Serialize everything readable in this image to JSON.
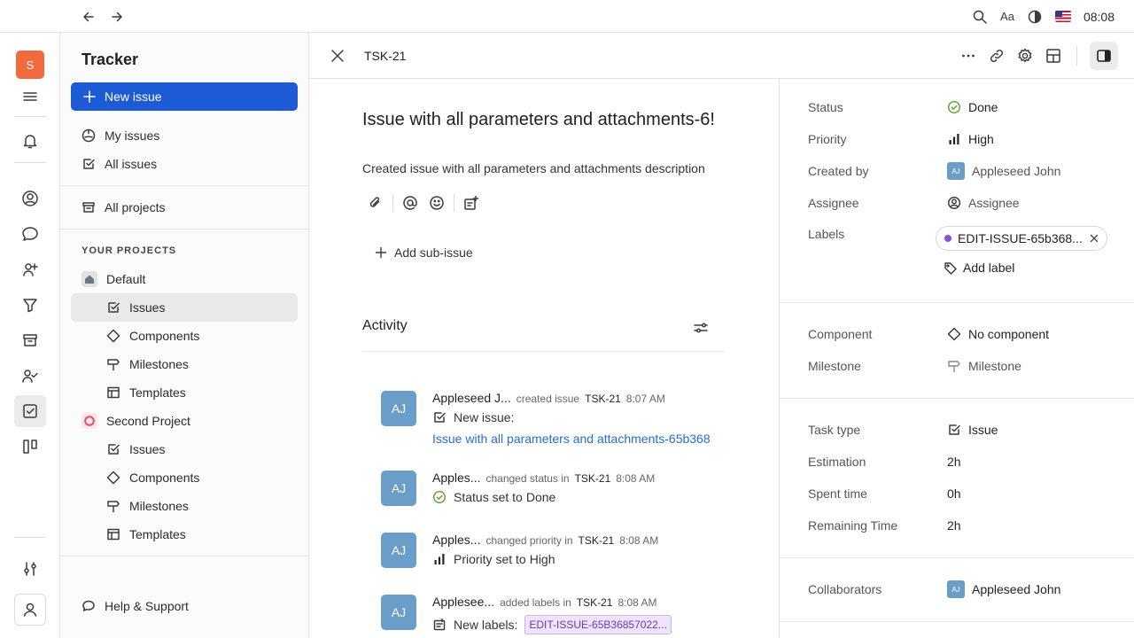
{
  "topbar": {
    "time": "08:08"
  },
  "rail": {
    "workspace_initial": "S"
  },
  "sidebar": {
    "title": "Tracker",
    "new_issue": "New issue",
    "my_issues": "My issues",
    "all_issues": "All issues",
    "all_projects": "All projects",
    "section_label": "YOUR PROJECTS",
    "projects": [
      {
        "name": "Default",
        "items": [
          "Issues",
          "Components",
          "Milestones",
          "Templates"
        ]
      },
      {
        "name": "Second Project",
        "items": [
          "Issues",
          "Components",
          "Milestones",
          "Templates"
        ]
      }
    ],
    "help": "Help & Support"
  },
  "header": {
    "issue_id": "TSK-21"
  },
  "issue": {
    "title": "Issue with all parameters and attachments-6!",
    "description": "Created issue with all parameters and attachments description",
    "add_sub_issue": "Add sub-issue"
  },
  "activity": {
    "title": "Activity",
    "entries": [
      {
        "initials": "AJ",
        "who": "Appleseed J...",
        "action": "created issue",
        "ref": "TSK-21",
        "time": "8:07 AM",
        "text": "New issue:",
        "link": "Issue with all parameters and attachments-65b368"
      },
      {
        "initials": "AJ",
        "who": "Apples...",
        "action": "changed status in",
        "ref": "TSK-21",
        "time": "8:08 AM",
        "text": "Status set to",
        "value": "Done"
      },
      {
        "initials": "AJ",
        "who": "Apples...",
        "action": "changed priority in",
        "ref": "TSK-21",
        "time": "8:08 AM",
        "text": "Priority set to",
        "value": "High"
      },
      {
        "initials": "AJ",
        "who": "Applesee...",
        "action": "added labels in",
        "ref": "TSK-21",
        "time": "8:08 AM",
        "text": "New labels:",
        "chip": "EDIT-ISSUE-65B36857022..."
      }
    ]
  },
  "panel": {
    "status_label": "Status",
    "status_value": "Done",
    "priority_label": "Priority",
    "priority_value": "High",
    "created_by_label": "Created by",
    "created_by_value": "Appleseed John",
    "created_by_initials": "AJ",
    "assignee_label": "Assignee",
    "assignee_value": "Assignee",
    "labels_label": "Labels",
    "label_chip": "EDIT-ISSUE-65b368...",
    "add_label": "Add label",
    "component_label": "Component",
    "component_value": "No component",
    "milestone_label": "Milestone",
    "milestone_value": "Milestone",
    "task_type_label": "Task type",
    "task_type_value": "Issue",
    "estimation_label": "Estimation",
    "estimation_value": "2h",
    "spent_label": "Spent time",
    "spent_value": "0h",
    "remaining_label": "Remaining Time",
    "remaining_value": "2h",
    "collaborators_label": "Collaborators",
    "collaborators_value": "Appleseed John",
    "collaborators_initials": "AJ"
  },
  "colors": {
    "accent": "#1d5bd6",
    "link": "#2a6bd1",
    "avatar": "#6a9ec8",
    "workspace": "#f06a3d",
    "label_dot": "#8a4fd8"
  }
}
